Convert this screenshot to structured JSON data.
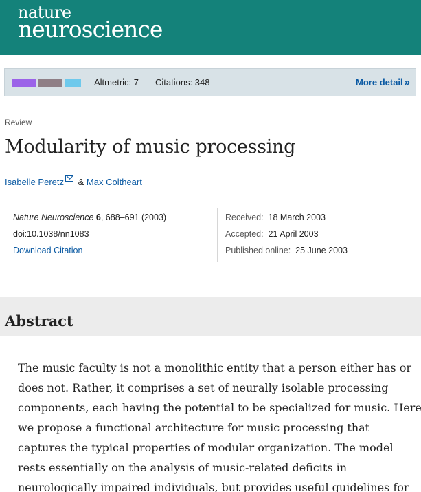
{
  "header": {
    "brand_top": "nature",
    "brand_bottom": "neuroscience",
    "background_color": "#14827a"
  },
  "metrics": {
    "swatch_colors": [
      "#9b63e8",
      "#8f7f86",
      "#6ec9ec"
    ],
    "altmetric": "Altmetric: 7",
    "citations": "Citations: 348",
    "more_detail": "More detail",
    "more_detail_icon": "double-chevron-right-icon"
  },
  "article": {
    "type": "Review",
    "title": "Modularity of music processing",
    "authors": [
      {
        "name": "Isabelle Peretz",
        "has_email_icon": true
      },
      {
        "name": "Max Coltheart"
      }
    ],
    "author_separator": "&"
  },
  "info": {
    "journal": "Nature Neuroscience",
    "volume": "6",
    "pages_year": ", 688–691 (2003)",
    "doi": "doi:10.1038/nn1083",
    "download": "Download Citation",
    "received_label": "Received:",
    "received": "18 March 2003",
    "accepted_label": "Accepted:",
    "accepted": "21 April 2003",
    "published_label": "Published online:",
    "published": "25 June 2003"
  },
  "abstract": {
    "heading": "Abstract",
    "lines": [
      "The music faculty is not a monolithic entity that a person either has or",
      "does not. Rather, it comprises a set of neurally isolable processing",
      "components, each having the potential to be specialized for music. Here",
      "we propose a functional architecture for music processing that",
      "captures the typical properties of modular organization. The model",
      "rests essentially on the analysis of music-related deficits in",
      "neurologically impaired individuals, but provides useful guidelines for"
    ]
  }
}
